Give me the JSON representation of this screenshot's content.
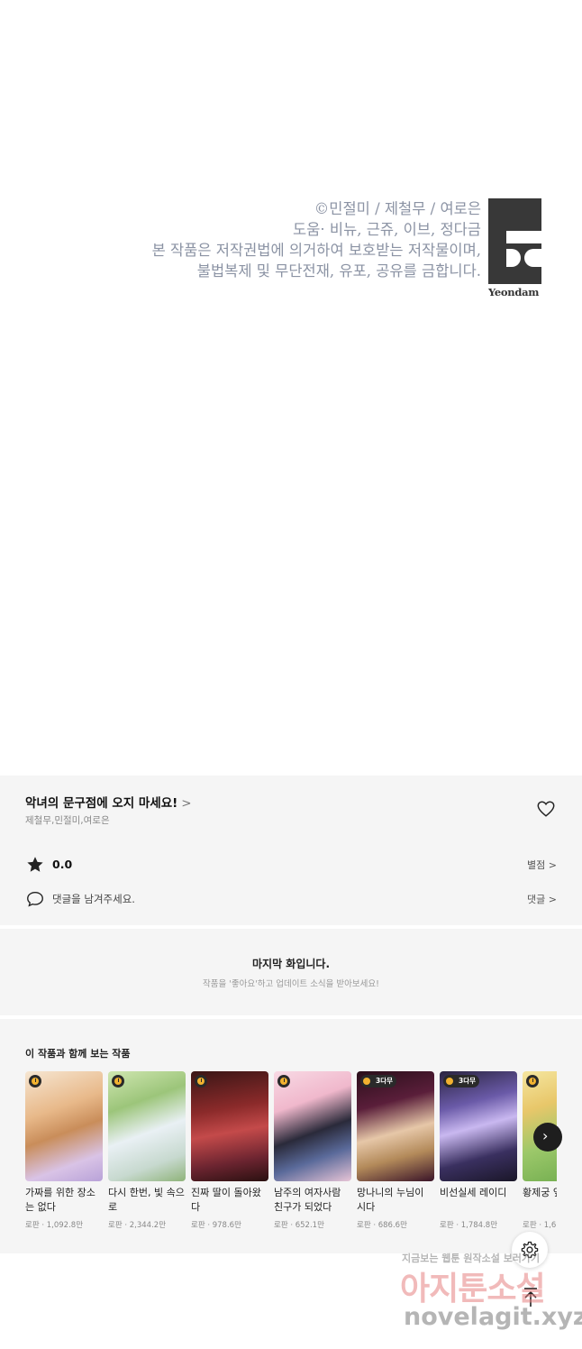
{
  "copyright": {
    "lines": [
      "©민절미 / 제철무 / 여로은",
      "도움· 비뉴, 근쥬, 이브, 정다금",
      "본 작품은 저작권법에 의거하여 보호받는 저작물이며,",
      "불법복제 및 무단전재, 유포, 공유를 금합니다."
    ],
    "logo_word": "Yeondam"
  },
  "series": {
    "title": "악녀의 문구점에 오지 마세요!",
    "title_chevron": ">",
    "authors": "제철무,민절미,여로은",
    "rating": "0.0",
    "rating_link": "별점 >",
    "comment_prompt": "댓글을 남겨주세요.",
    "comment_link": "댓글 >"
  },
  "last_episode": {
    "title": "마지막 화입니다.",
    "subtitle": "작품을 '좋아요'하고 업데이트 소식을 받아보세요!"
  },
  "recommendations": {
    "heading": "이 작품과 함께 보는 작품",
    "items": [
      {
        "name": "가짜를 위한 장소는 없다",
        "meta": "로판 · 1,092.8만",
        "badge": ""
      },
      {
        "name": "다시 한번, 빛 속으로",
        "meta": "로판 · 2,344.2만",
        "badge": ""
      },
      {
        "name": "진짜 딸이 돌아왔다",
        "meta": "로판 · 978.6만",
        "badge": ""
      },
      {
        "name": "남주의 여자사람 친구가 되었다",
        "meta": "로판 · 652.1만",
        "badge": ""
      },
      {
        "name": "망나니의 누님이 시다",
        "meta": "로판 · 686.6만",
        "badge": "3다무"
      },
      {
        "name": "비선실세 레이디",
        "meta": "로판 · 1,784.8만",
        "badge": "3다무"
      },
      {
        "name": "황제궁 옆에 농장",
        "meta": "로판 · 1,6",
        "badge": ""
      }
    ]
  },
  "watermark": {
    "line1": "지금보는 웹툰 원작소설 보러가기",
    "line2": "아지툰소설",
    "line3": "novelagit.xyz"
  },
  "icons": {
    "heart": "heart-icon",
    "star": "star-icon",
    "comment": "speech-bubble-icon",
    "next": "chevron-right-icon",
    "settings": "gear-icon",
    "scroll_top": "arrow-up-icon"
  }
}
